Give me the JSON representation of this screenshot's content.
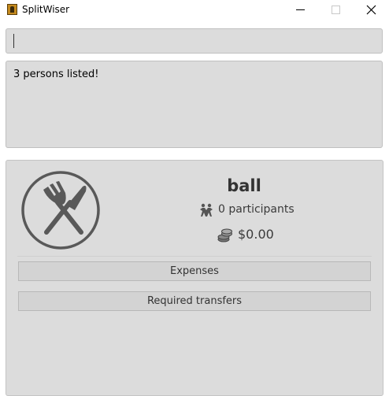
{
  "window": {
    "title": "SplitWiser",
    "icon": "splitwiser-app-icon"
  },
  "command_box": {
    "value": ""
  },
  "result_display": {
    "text": "3 persons listed!"
  },
  "event_card": {
    "icon": "fork-knife-icon",
    "name": "ball",
    "participants_icon": "people-icon",
    "participants_text": "0 participants",
    "amount_icon": "coins-icon",
    "amount_text": "$0.00",
    "buttons": {
      "expenses": "Expenses",
      "required_transfers": "Required transfers"
    }
  },
  "colors": {
    "panel_bg": "#dcdcdc",
    "icon_gray": "#595959",
    "text_dark": "#333333"
  }
}
